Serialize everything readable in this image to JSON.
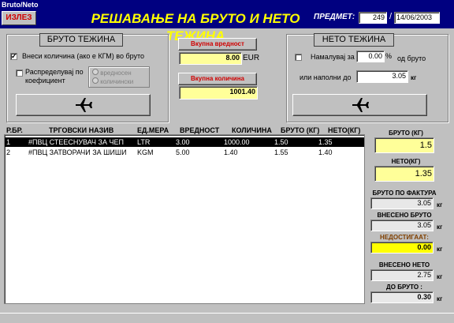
{
  "window": {
    "title": "Bruto/Neto"
  },
  "header": {
    "exit_label": "ИЗЛЕЗ",
    "title": "РЕШАВАЊЕ НА БРУТО И НЕТО ТЕЖИНА",
    "subject_label": "ПРЕДМЕТ:",
    "subject_number": "249",
    "separator": "/",
    "subject_date": "14/06/2003"
  },
  "bruto_panel": {
    "title": "БРУТО ТЕЖИНА",
    "enter_qty_label": "Внеси количина (ако е КГМ) во бруто",
    "enter_qty_checked": true,
    "distribute_label_1": "Распределувај по",
    "distribute_label_2": "коефициент",
    "distribute_checked": false,
    "radio_value": "вредносен",
    "radio_qty": "количински"
  },
  "middle_panel": {
    "total_value_label": "Вкупна вредност",
    "total_value": "8.00",
    "currency": "EUR",
    "total_qty_label": "Вкупна количина",
    "total_qty": "1001.40"
  },
  "neto_panel": {
    "title": "НЕТО ТЕЖИНА",
    "reduce_label": "Намалувај за",
    "reduce_checked": false,
    "reduce_value": "0.00",
    "percent": "%",
    "from_bruto": "од бруто",
    "fill_label": "или наполни до",
    "fill_value": "3.05",
    "unit": "кг"
  },
  "table": {
    "columns": [
      "Р.БР.",
      "ТРГОВСКИ НАЗИВ",
      "ЕД.МЕРА",
      "ВРЕДНОСТ",
      "КОЛИЧИНА",
      "БРУТО (КГ)",
      "НЕТО(КГ)"
    ],
    "rows": [
      {
        "no": "1",
        "name": "#ПВЦ СТЕЕСНУВАЧ ЗА ЧЕП",
        "unit": "LTR",
        "value": "3.00",
        "qty": "1000.00",
        "bruto": "1.50",
        "neto": "1.35"
      },
      {
        "no": "2",
        "name": "#ПВЦ ЗАТВОРАЧИ ЗА ШИШИ",
        "unit": "KGM",
        "value": "5.00",
        "qty": "1.40",
        "bruto": "1.55",
        "neto": "1.40"
      }
    ]
  },
  "right_panel": {
    "bruto_label": "БРУТО (КГ)",
    "bruto_value": "1.5",
    "neto_label": "НЕТО(КГ)",
    "neto_value": "1.35",
    "invoice_bruto_label": "БРУТО ПО ФАКТУРА",
    "invoice_bruto_value": "3.05",
    "entered_bruto_label": "ВНЕСЕНО  БРУТО",
    "entered_bruto_value": "3.05",
    "missing_label": "НЕДОСТИГААТ:",
    "missing_value": "0.00",
    "entered_neto_label": "ВНЕСЕНО  НЕТО",
    "entered_neto_value": "2.75",
    "to_bruto_label": "ДО БРУТО :",
    "to_bruto_value": "0.30",
    "unit": "кг"
  },
  "colors": {
    "header_bg": "#000080",
    "title_fg": "#ffff00",
    "exit_fg": "#d00000",
    "highlight": "#ffff99"
  }
}
